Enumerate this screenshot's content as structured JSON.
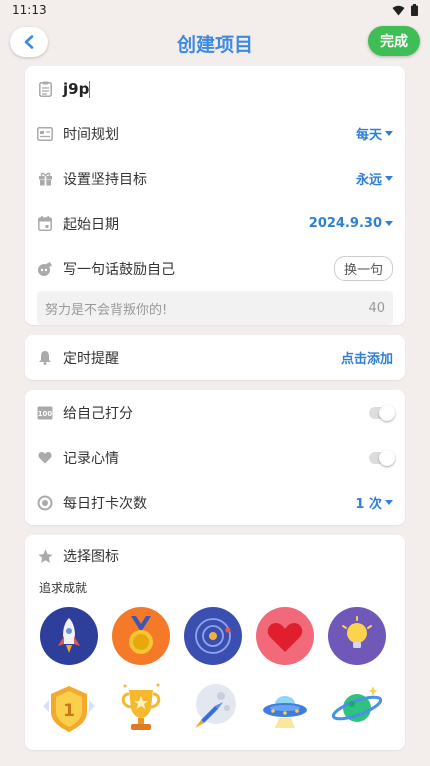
{
  "status": {
    "time": "11:13"
  },
  "header": {
    "title": "创建项目",
    "done_label": "完成"
  },
  "form": {
    "name_value": "j9p",
    "schedule": {
      "label": "时间规划",
      "value": "每天"
    },
    "goal": {
      "label": "设置坚持目标",
      "value": "永远"
    },
    "start_date": {
      "label": "起始日期",
      "value": "2024.9.30"
    },
    "motto": {
      "label": "写一句话鼓励自己",
      "swap_label": "换一句",
      "text": "努力是不会背叛你的!",
      "count": "40"
    }
  },
  "reminder": {
    "label": "定时提醒",
    "action": "点击添加"
  },
  "options": {
    "score": {
      "label": "给自己打分"
    },
    "mood": {
      "label": "记录心情"
    },
    "checkins": {
      "label": "每日打卡次数",
      "value": "1 次"
    }
  },
  "icons_section": {
    "label": "选择图标",
    "category": "追求成就",
    "icons": [
      "rocket-icon",
      "medal-icon",
      "orbit-icon",
      "heart-icon",
      "bulb-icon",
      "trophy-badge-icon",
      "trophy-cup-icon",
      "moon-rocket-icon",
      "ufo-icon",
      "planet-icon"
    ]
  },
  "colors": {
    "accent": "#3d8ae0",
    "done": "#3fbe55",
    "background": "#f3eeec"
  }
}
